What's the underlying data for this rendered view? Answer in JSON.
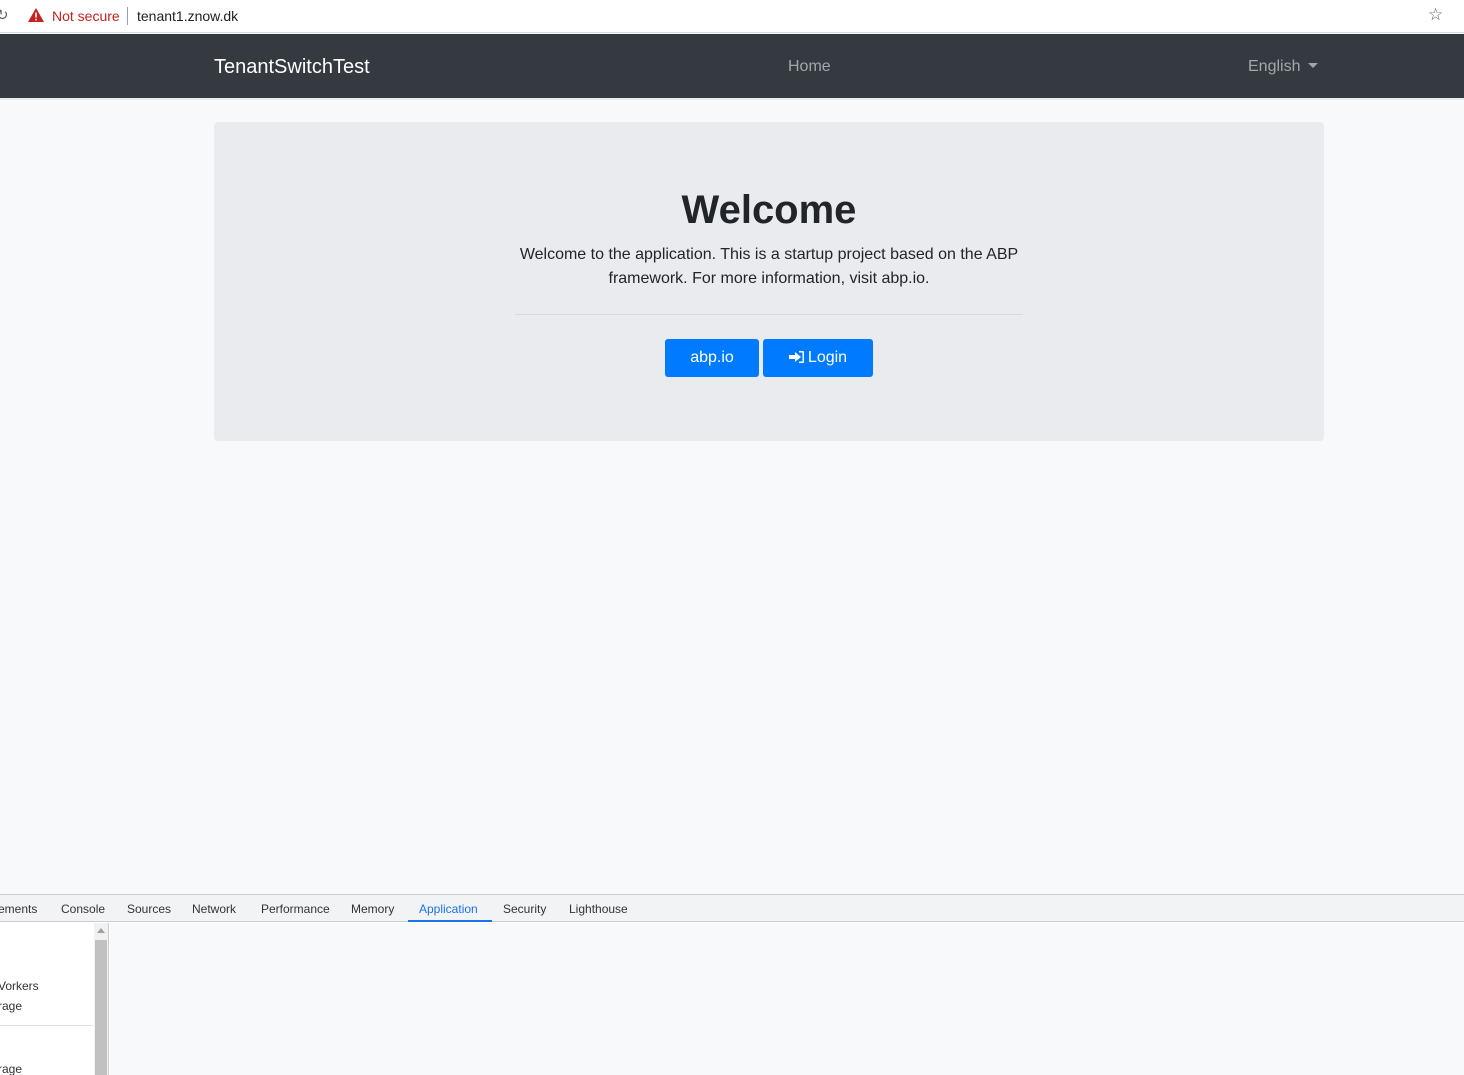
{
  "browser": {
    "security_label": "Not secure",
    "url": "tenant1.znow.dk",
    "icons": {
      "warning": "warning-triangle-icon",
      "bookmark": "star-icon",
      "reload": "reload-icon"
    }
  },
  "navbar": {
    "brand": "TenantSwitchTest",
    "home": "Home",
    "language": "English"
  },
  "jumbotron": {
    "title": "Welcome",
    "text": "Welcome to the application. This is a startup project based on the ABP framework. For more information, visit abp.io.",
    "buttons": {
      "abp_label": "abp.io",
      "login_label": "Login"
    }
  },
  "devtools": {
    "tabs": [
      {
        "label": "ements"
      },
      {
        "label": "Console"
      },
      {
        "label": "Sources"
      },
      {
        "label": "Network"
      },
      {
        "label": "Performance"
      },
      {
        "label": "Memory"
      },
      {
        "label": "Application",
        "active": true
      },
      {
        "label": "Security"
      },
      {
        "label": "Lighthouse"
      }
    ],
    "sidebar_items": [
      {
        "label": "Vorkers"
      },
      {
        "label": "rage"
      },
      {
        "label": "rage"
      }
    ]
  },
  "colors": {
    "primary": "#007bff",
    "navbar": "#343a40",
    "warning": "#c5221f",
    "devtools_active": "#1a73e8"
  }
}
